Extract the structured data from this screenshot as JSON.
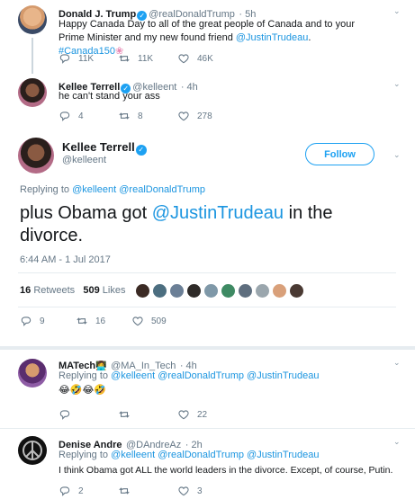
{
  "tweet1": {
    "name": "Donald J. Trump",
    "handle": "@realDonaldTrump",
    "time": "· 5h",
    "text_a": "Happy Canada Day to all of the great people of Canada and to your Prime Minister and my new found friend ",
    "mention": "@JustinTrudeau",
    "hashtag": "#Canada150",
    "replies": "11K",
    "retweets": "11K",
    "likes": "46K"
  },
  "tweet2": {
    "name": "Kellee Terrell",
    "handle": "@kelleent",
    "time": "· 4h",
    "text": "he can't stand your ass",
    "replies": "4",
    "retweets": "8",
    "likes": "278"
  },
  "main": {
    "name": "Kellee Terrell",
    "handle": "@kelleent",
    "follow": "Follow",
    "replying_prefix": "Replying to ",
    "replying_to_1": "@kelleent",
    "replying_to_2": "@realDonaldTrump",
    "text_a": "plus Obama got ",
    "mention": "@JustinTrudeau",
    "text_b": " in the divorce.",
    "timestamp": "6:44 AM - 1 Jul 2017",
    "retweet_count": "16",
    "retweets_label": "Retweets",
    "like_count": "509",
    "likes_label": "Likes",
    "replies": "9",
    "retweets": "16",
    "likes": "509"
  },
  "reply1": {
    "name": "MATech",
    "handle": "@MA_In_Tech",
    "time": "· 4h",
    "replying_prefix": "Replying to ",
    "replying_to": "@kelleent @realDonaldTrump @JustinTrudeau",
    "emoji_text": "😂🤣😂🤣",
    "likes": "22"
  },
  "reply2": {
    "name": "Denise Andre",
    "handle": "@DAndreAz",
    "time": "· 2h",
    "replying_prefix": "Replying to ",
    "replying_to": "@kelleent @realDonaldTrump @JustinTrudeau",
    "text": "I think Obama got ALL the world leaders in the divorce. Except, of course, Putin.",
    "replies": "2",
    "likes": "3"
  },
  "colors": {
    "accent": "#1da1f2",
    "link": "#1b95e0",
    "secondary": "#657786",
    "divider": "#e6ecf0"
  }
}
